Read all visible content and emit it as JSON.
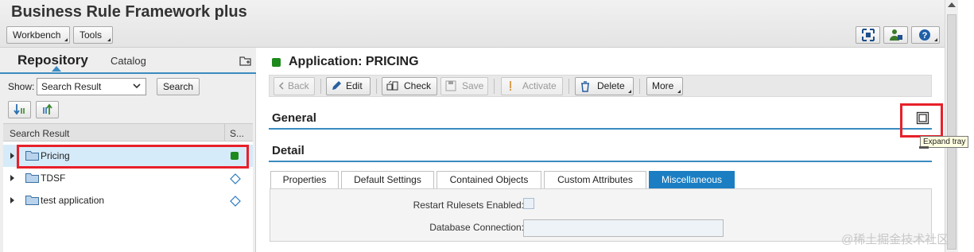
{
  "header": {
    "app_title": "Business Rule Framework plus",
    "menus": [
      {
        "label": "Workbench"
      },
      {
        "label": "Tools"
      }
    ],
    "right_icons": [
      "fullscreen-icon",
      "user-settings-icon",
      "help-icon"
    ]
  },
  "repository": {
    "active_tab": "Repository",
    "other_tab": "Catalog",
    "show_label": "Show:",
    "show_value": "Search Result",
    "search_button": "Search",
    "columns": [
      "Search Result",
      "S..."
    ],
    "items": [
      {
        "label": "Pricing",
        "status": "active",
        "selected": true
      },
      {
        "label": "TDSF",
        "status": "inactive",
        "selected": false
      },
      {
        "label": "test application",
        "status": "inactive",
        "selected": false
      }
    ]
  },
  "main": {
    "heading": "Application: PRICING",
    "toolbar": {
      "back": "Back",
      "edit": "Edit",
      "check": "Check",
      "save": "Save",
      "activate": "Activate",
      "delete": "Delete",
      "more": "More"
    },
    "general_title": "General",
    "detail_title": "Detail",
    "tooltip": "Expand tray",
    "tabs": [
      {
        "label": "Properties",
        "active": false
      },
      {
        "label": "Default Settings",
        "active": false
      },
      {
        "label": "Contained Objects",
        "active": false
      },
      {
        "label": "Custom Attributes",
        "active": false
      },
      {
        "label": "Miscellaneous",
        "active": true
      }
    ],
    "fields": {
      "restart_label": "Restart Rulesets Enabled:",
      "db_label": "Database Connection:",
      "db_value": ""
    }
  },
  "watermark": "@稀土掘金技术社区",
  "colors": {
    "accent": "#1b7ec2",
    "active_status": "#1e8a1e",
    "highlight_box": "#e8202a"
  }
}
